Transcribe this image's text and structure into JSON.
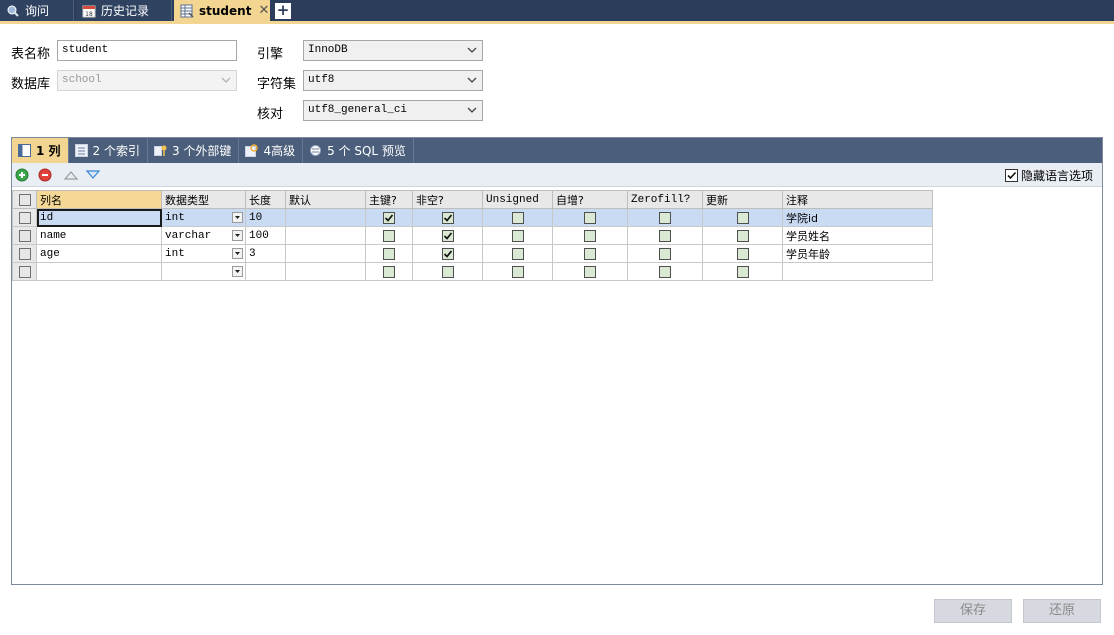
{
  "tabs": {
    "query_label": "询问",
    "history_label": "历史记录",
    "history_icon_text": "18",
    "student_label": "student",
    "close_glyph": "✕",
    "new_glyph": "+"
  },
  "form": {
    "table_name_label": "表名称",
    "table_name_value": "student",
    "database_label": "数据库",
    "database_value": "school",
    "engine_label": "引擎",
    "engine_value": "InnoDB",
    "charset_label": "字符集",
    "charset_value": "utf8",
    "collation_label": "核对",
    "collation_value": "utf8_general_ci"
  },
  "subtabs": {
    "columns": "1 列",
    "indexes": "2 个索引",
    "foreign_keys": "3 个外部键",
    "advanced": "4高级",
    "sql_preview": "5 个 SQL 预览"
  },
  "toolbar": {
    "hide_language_label": "隐藏语言选项",
    "hide_language_checked": true
  },
  "grid": {
    "headers": {
      "name": "列名",
      "type": "数据类型",
      "length": "长度",
      "default": "默认",
      "primary": "主键?",
      "not_null": "非空?",
      "unsigned": "Unsigned",
      "auto_inc": "自增?",
      "zerofill": "Zerofill?",
      "update": "更新",
      "comment": "注释"
    },
    "rows": [
      {
        "name": "id",
        "type": "int",
        "length": "10",
        "default": "",
        "primary": true,
        "not_null": true,
        "unsigned": false,
        "auto_inc": false,
        "zerofill": false,
        "update": false,
        "comment": "学院id"
      },
      {
        "name": "name",
        "type": "varchar",
        "length": "100",
        "default": "",
        "primary": false,
        "not_null": true,
        "unsigned": false,
        "auto_inc": false,
        "zerofill": false,
        "update": false,
        "comment": "学员姓名"
      },
      {
        "name": "age",
        "type": "int",
        "length": "3",
        "default": "",
        "primary": false,
        "not_null": true,
        "unsigned": false,
        "auto_inc": false,
        "zerofill": false,
        "update": false,
        "comment": "学员年龄"
      },
      {
        "name": "",
        "type": "",
        "length": "",
        "default": "",
        "primary": false,
        "not_null": false,
        "unsigned": false,
        "auto_inc": false,
        "zerofill": false,
        "update": false,
        "comment": ""
      }
    ]
  },
  "buttons": {
    "save": "保存",
    "revert": "还原"
  },
  "colors": {
    "tabbar": "#2b3d5a",
    "active_tab": "#f3d592",
    "subtabbar": "#4b5f7c",
    "selected_row": "#c9dbf3",
    "checkbox_fill": "#d9e9d3"
  }
}
